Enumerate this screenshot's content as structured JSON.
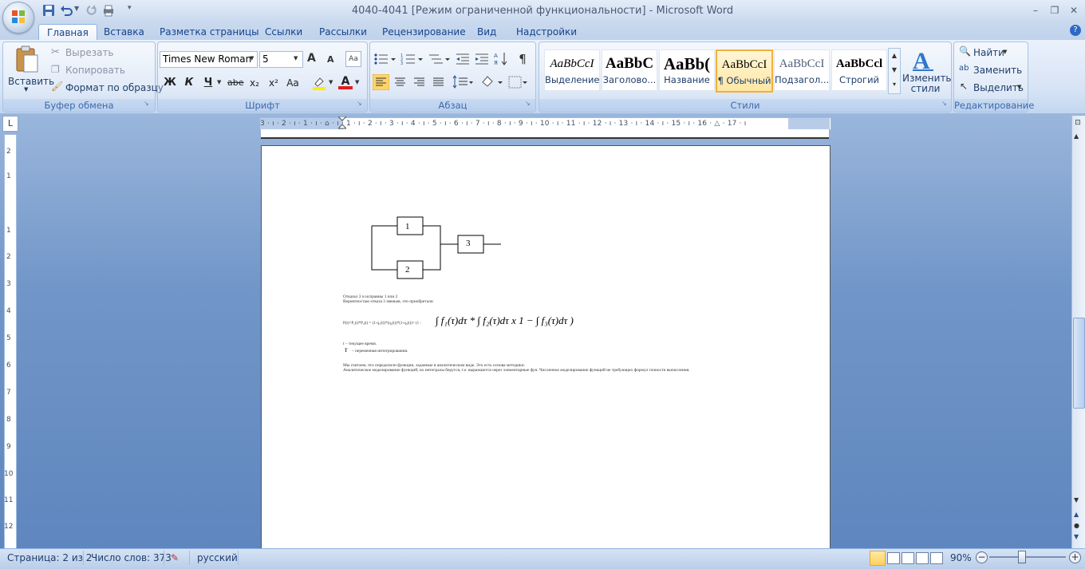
{
  "window": {
    "title": "4040-4041 [Режим ограниченной функциональности] - Microsoft Word",
    "controls": {
      "minimize": "–",
      "restore": "❐",
      "close": "✕"
    }
  },
  "quick_access": [
    "save-icon",
    "undo-icon",
    "redo-icon",
    "print-preview-icon",
    "customize-icon"
  ],
  "tabs": [
    "Главная",
    "Вставка",
    "Разметка страницы",
    "Ссылки",
    "Рассылки",
    "Рецензирование",
    "Вид",
    "Надстройки"
  ],
  "ribbon": {
    "clipboard": {
      "label": "Буфер обмена",
      "paste": "Вставить",
      "cut": "Вырезать",
      "copy": "Копировать",
      "format_painter": "Формат по образцу"
    },
    "font": {
      "label": "Шрифт",
      "font_name": "Times New Roman",
      "font_size": "5",
      "bold": "Ж",
      "italic": "К",
      "underline": "Ч",
      "strike": "abe",
      "subscript": "x₂",
      "superscript": "x²",
      "case": "Aa",
      "grow": "A",
      "shrink": "A"
    },
    "paragraph": {
      "label": "Абзац"
    },
    "styles": {
      "label": "Стили",
      "items": [
        {
          "preview": "AaBbCcI",
          "name": "Выделение"
        },
        {
          "preview": "AaBbC",
          "name": "Заголово..."
        },
        {
          "preview": "AaBb(",
          "name": "Название"
        },
        {
          "preview": "AaBbCcI",
          "name": "¶ Обычный"
        },
        {
          "preview": "AaBbCcI",
          "name": "Подзагол..."
        },
        {
          "preview": "AaBbCcl",
          "name": "Строгий"
        }
      ],
      "change_styles": "Изменить стили"
    },
    "editing": {
      "label": "Редактирование",
      "find": "Найти",
      "replace": "Заменить",
      "select": "Выделить"
    }
  },
  "ruler": {
    "horizontal": "3 · ı · 2 · ı · 1 · ı · ⌂ · ı · 1 · ı · 2 · ı · 3 · ı · 4 · ı · 5 · ı · 6 · ı · 7 · ı · 8 · ı · 9 · ı · 10 · ı · 11 · ı · 12 · ı · 13 · ı · 14 · ı · 15 · ı · 16 · △ · 17 · ı",
    "vertical": [
      "2",
      "1",
      "1",
      "2",
      "3",
      "4",
      "5",
      "6",
      "7",
      "8",
      "9",
      "10",
      "11",
      "12"
    ]
  },
  "document": {
    "diagram": {
      "block1": "1",
      "block2": "2",
      "block3": "3"
    },
    "line1": "Отказал 3 и исправны 1 или 2",
    "line2": "Вероятностью отказа 3 звеньев, что приобретали",
    "formula_prefix": "P(t)=P₁(t)*P₂(t) = (1-q₁(t))*(q₂(t))*(1-q₃(t))= (1 -",
    "formula_body": "∫ f₁(τ)dτ * ∫ f₂(τ)dτ x 1 − ∫ f₃(τ)dτ )",
    "line3": "t – текущее время.",
    "line4": "– переменная интегрирования.",
    "tau": "τ",
    "line5": "Мы считаем, что определили функции, заданные в аналитическом виде. Это есть основа методики.",
    "line6": "Аналитическое моделирование функций, их интегралы берутся, т.е. выражаются через элементарные фун. Численное моделирование функций не требующих формул точности вычисления."
  },
  "status": {
    "page": "Страница: 2 из 2",
    "words": "Число слов: 373",
    "language": "русский",
    "zoom": "90%"
  }
}
